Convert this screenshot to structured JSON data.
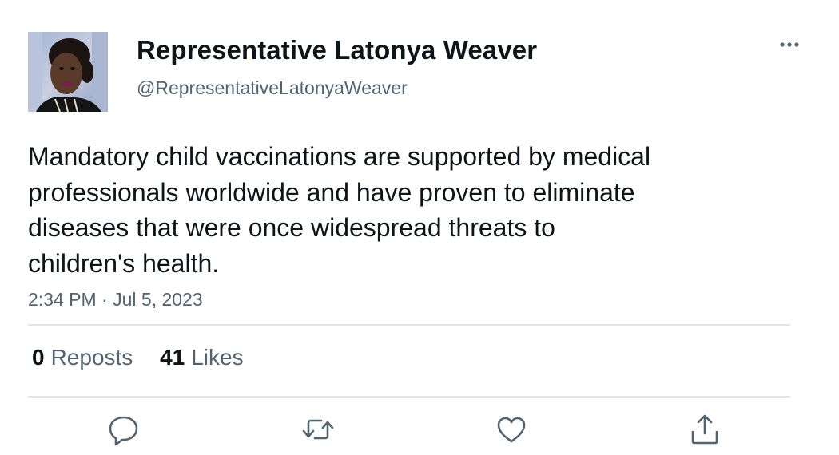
{
  "author": {
    "display_name": "Representative Latonya Weaver",
    "handle": "@RepresentativeLatonyaWeaver",
    "avatar_icon": "profile-photo"
  },
  "tweet": {
    "text_lines": [
      "Mandatory child vaccinations are supported by medical",
      "professionals worldwide and have proven to eliminate",
      "diseases that were once widespread threats to",
      "children's health."
    ],
    "time": "2:34 PM",
    "separator": "·",
    "date": "Jul 5, 2023"
  },
  "stats": {
    "reposts_count": "0",
    "reposts_label": "Reposts",
    "likes_count": "41",
    "likes_label": "Likes"
  },
  "actions": {
    "reply_icon": "reply-icon",
    "repost_icon": "repost-icon",
    "like_icon": "heart-icon",
    "share_icon": "share-icon",
    "more_icon": "more-dots-icon"
  },
  "colors": {
    "text_primary": "#0f1419",
    "text_secondary": "#536471",
    "divider": "#e1e5e8",
    "icon": "#536471"
  }
}
